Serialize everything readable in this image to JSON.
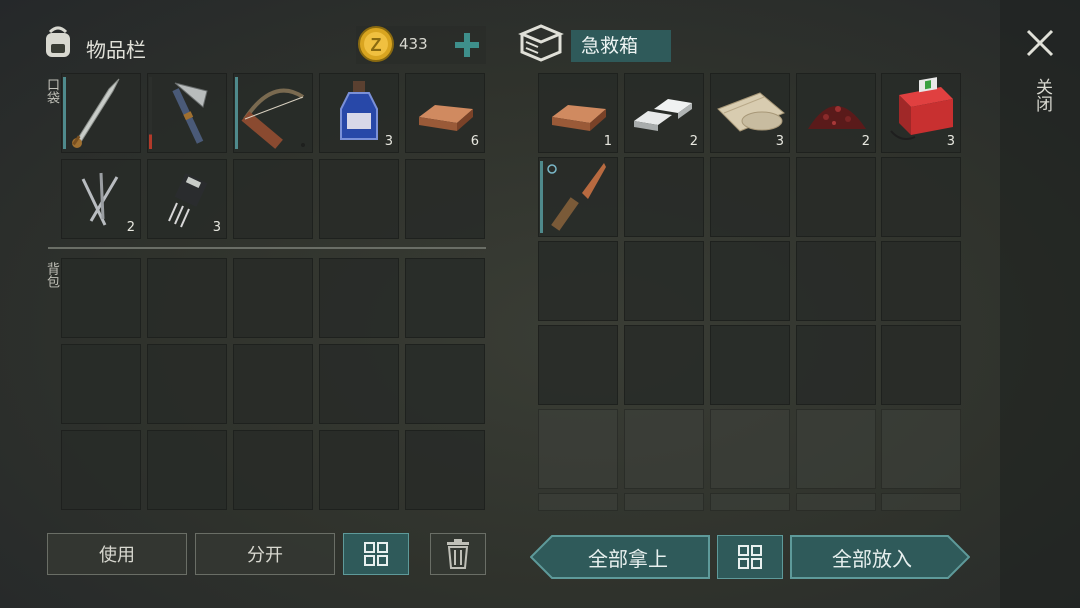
{
  "inventory": {
    "title": "物品栏",
    "coins": "433",
    "pockets_label": "口袋",
    "backpack_label": "背包",
    "pocket_items": [
      {
        "name": "sword",
        "count": ""
      },
      {
        "name": "hatchet",
        "count": ""
      },
      {
        "name": "crossbow",
        "count": ""
      },
      {
        "name": "blue-bottle",
        "count": "3"
      },
      {
        "name": "copper-ingot",
        "count": "6"
      },
      {
        "name": "nails",
        "count": "2"
      },
      {
        "name": "transistor",
        "count": "3"
      }
    ]
  },
  "container": {
    "title": "急救箱",
    "items": [
      {
        "name": "copper-ingot",
        "count": "1"
      },
      {
        "name": "iron-ingot",
        "count": "2"
      },
      {
        "name": "cloth-roll",
        "count": "3"
      },
      {
        "name": "dried-berries",
        "count": "2"
      },
      {
        "name": "first-aid-kit",
        "count": "3"
      },
      {
        "name": "knife",
        "count": ""
      }
    ]
  },
  "close_label": "关闭",
  "buttons": {
    "use": "使用",
    "split": "分开",
    "take_all": "全部拿上",
    "put_all": "全部放入"
  },
  "colors": {
    "accent": "#2f5a5a",
    "plus": "#3e8f8b",
    "coin": "#d9a520"
  }
}
